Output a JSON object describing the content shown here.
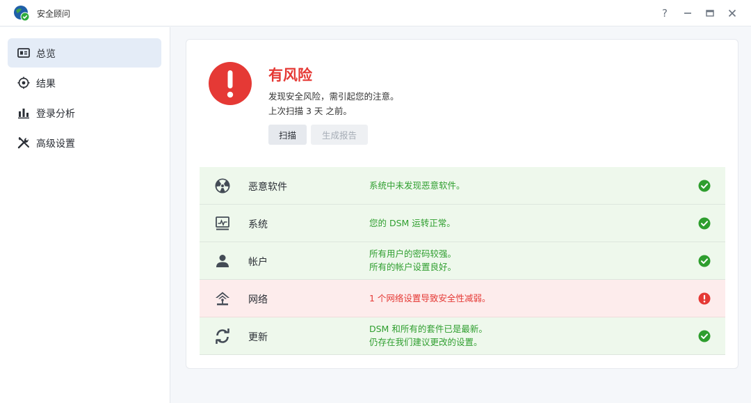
{
  "window": {
    "title": "安全顾问",
    "buttons": {
      "help": "?",
      "minimize": "—",
      "maximize": "□",
      "close": "✕"
    }
  },
  "sidebar": {
    "items": [
      {
        "label": "总览",
        "icon": "overview-icon",
        "active": true
      },
      {
        "label": "结果",
        "icon": "target-icon",
        "active": false
      },
      {
        "label": "登录分析",
        "icon": "bar-chart-icon",
        "active": false
      },
      {
        "label": "高级设置",
        "icon": "tools-icon",
        "active": false
      }
    ]
  },
  "overview": {
    "status_title": "有风险",
    "status_description": "发现安全风险，需引起您的注意。",
    "last_scan": "上次扫描 3 天 之前。",
    "scan_button": "扫描",
    "report_button": "生成报告"
  },
  "checks": [
    {
      "name": "恶意软件",
      "icon": "malware-icon",
      "messages": [
        "系统中未发现恶意软件。"
      ],
      "status": "ok"
    },
    {
      "name": "系统",
      "icon": "system-monitor-icon",
      "messages": [
        "您的 DSM 运转正常。"
      ],
      "status": "ok"
    },
    {
      "name": "帐户",
      "icon": "user-icon",
      "messages": [
        "所有用户的密码较强。",
        "所有的帐户设置良好。"
      ],
      "status": "ok"
    },
    {
      "name": "网络",
      "icon": "network-icon",
      "messages": [
        "1 个网络设置导致安全性减弱。"
      ],
      "status": "error"
    },
    {
      "name": "更新",
      "icon": "update-icon",
      "messages": [
        "DSM 和所有的套件已是最新。",
        "仍存在我们建议更改的设置。"
      ],
      "status": "ok"
    }
  ],
  "colors": {
    "risk_red": "#e53935",
    "ok_green": "#2e9e2e",
    "ok_row_bg": "#eef8ec",
    "err_row_bg": "#fdecec",
    "active_nav_bg": "#e4ecf7"
  }
}
